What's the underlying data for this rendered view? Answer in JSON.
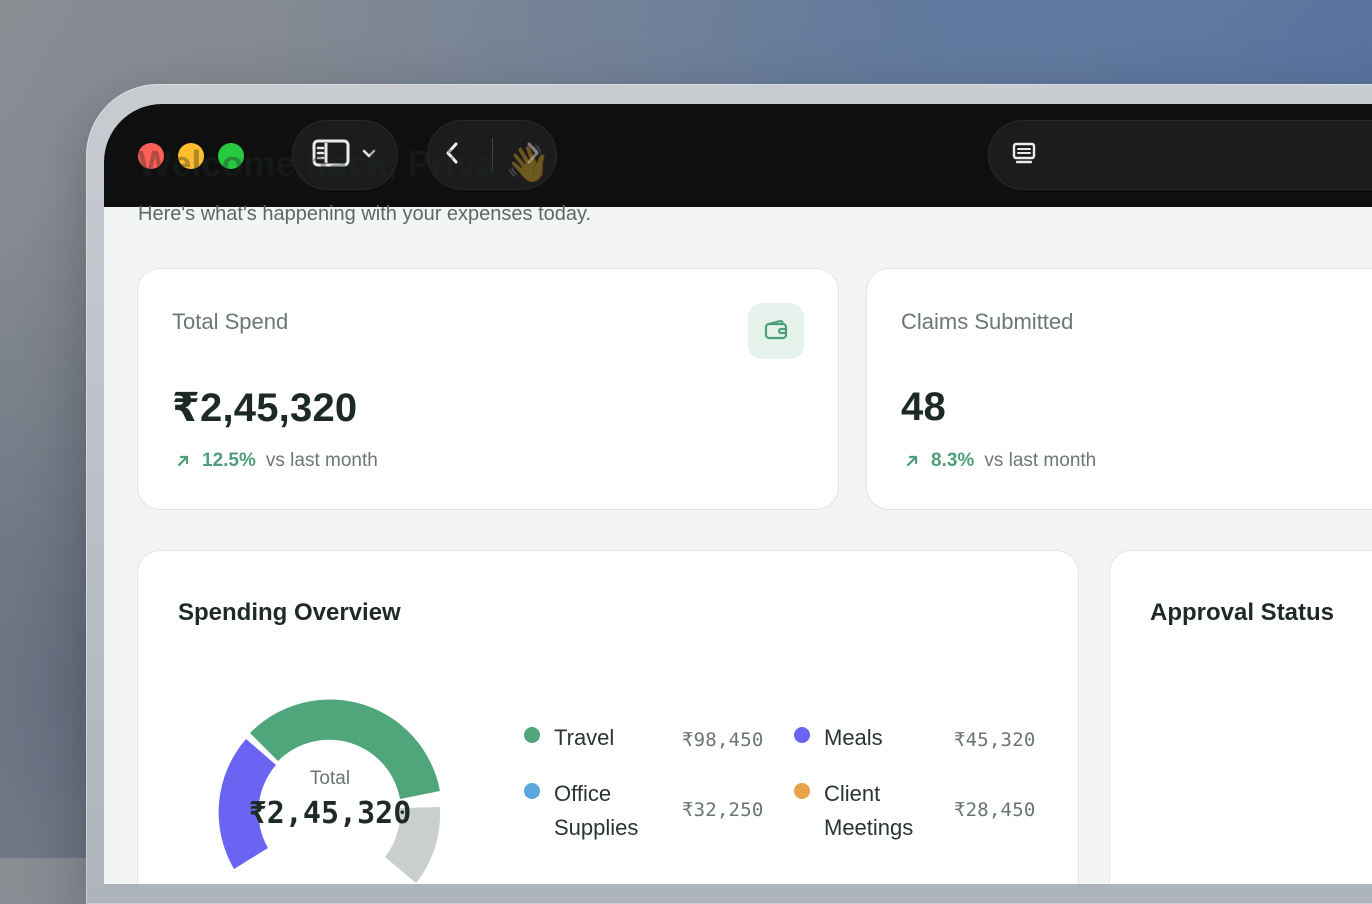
{
  "window": {
    "traffic_lights": [
      "close",
      "minimize",
      "zoom"
    ],
    "toolbar": {
      "sidebar_toggle_icon": "sidebar-icon",
      "sidebar_chevron_icon": "chevron-down-icon",
      "back_icon": "chevron-left-icon",
      "forward_icon": "chevron-right-icon",
      "address_icon": "page-icon"
    }
  },
  "page": {
    "greeting": "Welcome back, Priya 👋",
    "subtitle": "Here's what's happening with your expenses today."
  },
  "cards": {
    "total_spend": {
      "label": "Total Spend",
      "value": "₹2,45,320",
      "delta_pct": "12.5%",
      "delta_text": "vs last month",
      "icon": "wallet-icon"
    },
    "claims_submitted": {
      "label": "Claims Submitted",
      "value": "48",
      "delta_pct": "8.3%",
      "delta_text": "vs last month"
    }
  },
  "overview": {
    "title": "Spending Overview",
    "total_label": "Total",
    "total_value": "₹2,45,320",
    "legend": [
      {
        "name": "Travel",
        "amount": "₹98,450",
        "color": "#4fa67b"
      },
      {
        "name": "Meals",
        "amount": "₹45,320",
        "color": "#6b63f2"
      },
      {
        "name": "Office\nSupplies",
        "amount": "₹32,250",
        "color": "#5aa6df"
      },
      {
        "name": "Client\nMeetings",
        "amount": "₹28,450",
        "color": "#e7a24a"
      }
    ]
  },
  "approval": {
    "title": "Approval Status"
  },
  "colors": {
    "accent_green": "#4e9e7a",
    "donut_green": "#4fa67b",
    "donut_purple": "#6b63f2",
    "donut_gray": "#c9cfcc"
  }
}
